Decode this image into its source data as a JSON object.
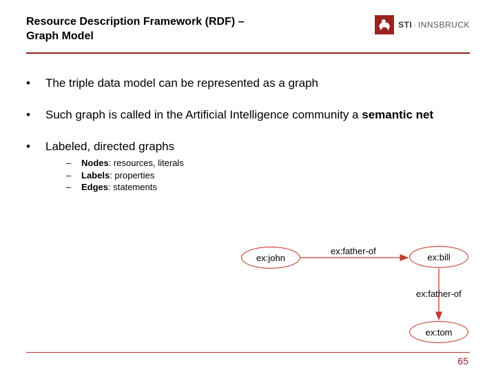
{
  "header": {
    "title_line1": "Resource Description Framework (RDF) –",
    "title_line2": "Graph Model",
    "logo_sti": "STI",
    "logo_innsbruck": "INNSBRUCK"
  },
  "bullets": {
    "b1": "The triple data model can be represented as a graph",
    "b2_prefix": "Such graph is called in the Artificial Intelligence community a ",
    "b2_strong": "semantic net",
    "b3": "Labeled, directed graphs"
  },
  "sub": {
    "nodes_lbl": "Nodes",
    "nodes_txt": ": resources, literals",
    "labels_lbl": "Labels",
    "labels_txt": ": properties",
    "edges_lbl": "Edges",
    "edges_txt": ": statements"
  },
  "graph": {
    "john": "ex:john",
    "bill": "ex:bill",
    "tom": "ex:tom",
    "edge1": "ex:father-of",
    "edge2": "ex:father-of"
  },
  "page": "65"
}
